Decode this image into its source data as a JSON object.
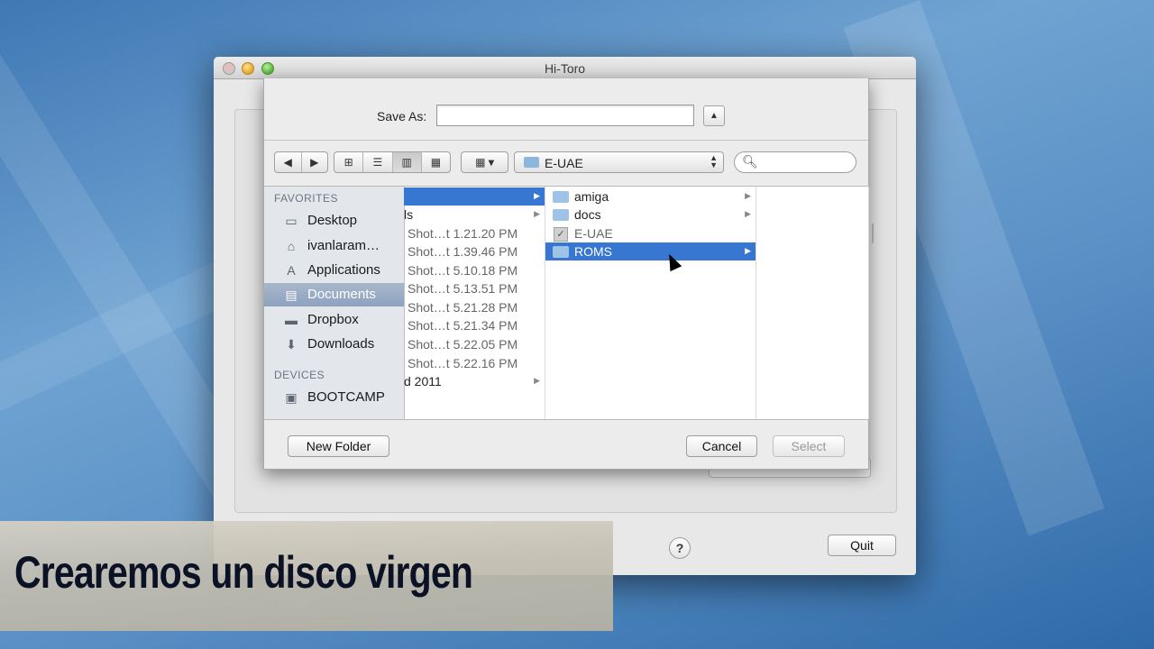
{
  "window": {
    "title": "Hi-Toro"
  },
  "save_sheet": {
    "save_as_label": "Save As:",
    "save_as_value": "",
    "expand_glyph": "▲",
    "nav": {
      "back": "◀",
      "forward": "▶"
    },
    "view_modes": [
      "icon-view",
      "list-view",
      "column-view",
      "coverflow-view"
    ],
    "arrange_glyph": "▾",
    "location": "E-UAE",
    "search_placeholder": "",
    "sidebar": {
      "favorites_header": "FAVORITES",
      "favorites": [
        {
          "label": "Desktop",
          "icon": "desktop-icon"
        },
        {
          "label": "ivanlaram…",
          "icon": "home-icon"
        },
        {
          "label": "Applications",
          "icon": "applications-icon"
        },
        {
          "label": "Documents",
          "icon": "documents-icon",
          "selected": true
        },
        {
          "label": "Dropbox",
          "icon": "folder-icon"
        },
        {
          "label": "Downloads",
          "icon": "downloads-icon"
        }
      ],
      "devices_header": "DEVICES",
      "devices": [
        {
          "label": "BOOTCAMP",
          "icon": "disk-icon"
        }
      ]
    },
    "column1": [
      {
        "label": "",
        "selected": true,
        "has_children": true
      },
      {
        "label": "ls",
        "has_children": true
      },
      {
        "label": "Shot…t 1.21.20 PM"
      },
      {
        "label": "Shot…t 1.39.46 PM"
      },
      {
        "label": "Shot…t 5.10.18 PM"
      },
      {
        "label": "Shot…t 5.13.51 PM"
      },
      {
        "label": "Shot…t 5.21.28 PM"
      },
      {
        "label": "Shot…t 5.21.34 PM"
      },
      {
        "label": "Shot…t 5.22.05 PM"
      },
      {
        "label": "Shot…t 5.22.16 PM"
      },
      {
        "label": "d 2011",
        "has_children": true
      }
    ],
    "column2": [
      {
        "label": "amiga",
        "type": "folder",
        "has_children": true
      },
      {
        "label": "docs",
        "type": "folder",
        "has_children": true
      },
      {
        "label": "E-UAE",
        "type": "app",
        "dim": true
      },
      {
        "label": "ROMS",
        "type": "folder",
        "selected": true,
        "has_children": true
      }
    ],
    "buttons": {
      "new_folder": "New Folder",
      "cancel": "Cancel",
      "select": "Select"
    }
  },
  "window_buttons": {
    "help": "?",
    "quit": "Quit"
  },
  "caption": "Crearemos un disco virgen"
}
